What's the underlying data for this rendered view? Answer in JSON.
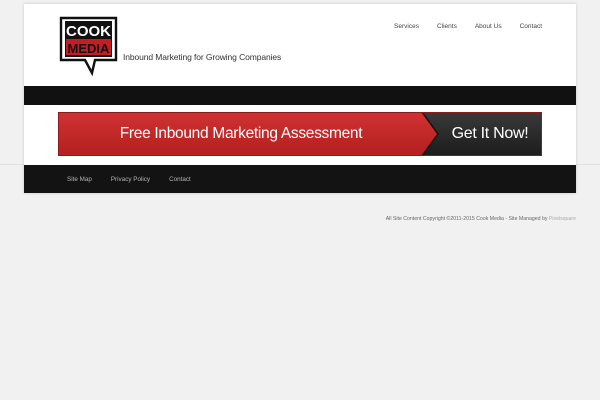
{
  "header": {
    "logo_text_line1": "COOK",
    "logo_text_line2": "MEDIA",
    "tagline": "Inbound Marketing for Growing Companies"
  },
  "nav": [
    {
      "label": "Services"
    },
    {
      "label": "Clients"
    },
    {
      "label": "About Us"
    },
    {
      "label": "Contact"
    }
  ],
  "cta": {
    "main_label": "Free Inbound Marketing Assessment",
    "button_label": "Get It Now!"
  },
  "footer_nav": [
    {
      "label": "Site Map"
    },
    {
      "label": "Privacy Policy"
    },
    {
      "label": "Contact"
    }
  ],
  "copyright": {
    "text": "All Site Content Copyright ©2011-2015 Cook Media - Site Managed by ",
    "link_label": "Pixelsquare"
  },
  "colors": {
    "logo_red": "#c41e24",
    "cta_red": "#c82a2a",
    "cta_dark": "#262626",
    "bar_black": "#111111",
    "background": "#f1f1f1"
  }
}
